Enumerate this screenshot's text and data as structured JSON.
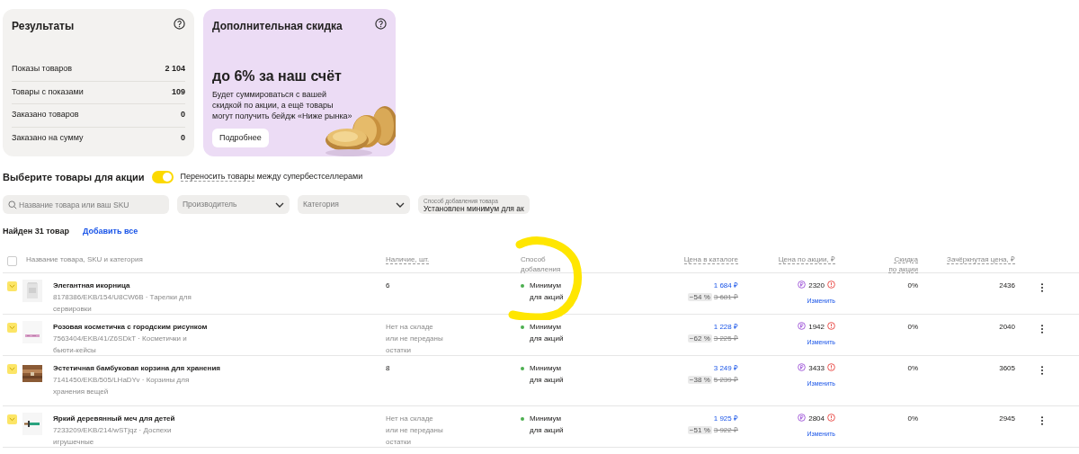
{
  "results_card": {
    "title": "Результаты",
    "stats": [
      {
        "label": "Показы товаров",
        "value": "2 104"
      },
      {
        "label": "Товары с показами",
        "value": "109"
      },
      {
        "label": "Заказано товаров",
        "value": "0"
      },
      {
        "label": "Заказано на сумму",
        "value": "0"
      }
    ]
  },
  "promo_card": {
    "title": "Дополнительная скидка",
    "headline": "до 6% за наш счёт",
    "text": "Будет суммироваться с вашей скидкой по акции, а ещё товары могут получить бейдж «Ниже рынка»",
    "button": "Подробнее"
  },
  "selection": {
    "title": "Выберите товары для акции",
    "toggle_on": true,
    "toggle_link": "Переносить товары",
    "toggle_text": "между супербестселлерами"
  },
  "filters": {
    "search_placeholder": "Название товара или ваш SKU",
    "dropdowns": [
      {
        "placeholder": "Производитель"
      },
      {
        "placeholder": "Категория"
      },
      {
        "label": "Способ добавления товара",
        "value": "Установлен минимум для ак"
      }
    ]
  },
  "found": "Найден 31 товар",
  "add_all": "Добавить все",
  "table": {
    "all_checked": false,
    "columns": [
      "Название товара, SKU и категория",
      "Наличие, шт.",
      "Способ добавления",
      "Цена в каталоге",
      "Цена по акции, ₽",
      "Скидка по акции",
      "Зачёркнутая цена, ₽"
    ],
    "rows": [
      {
        "checked": true,
        "name": "Элегантная икорница",
        "sku_category": "8178386/EKB/154/U8CW6B · Тарелки для сервировки",
        "stock": "6",
        "available": true,
        "method": "Минимум для акций",
        "catalog_price": "1 684 ₽",
        "discount_badge": "−54 %",
        "old_price": "3 681 ₽",
        "promo_price": "2320",
        "change_link": "Изменить",
        "promo_discount": "0%",
        "crossed_price": "2436"
      },
      {
        "checked": true,
        "name": "Розовая косметичка с городским рисунком",
        "sku_category": "7563404/EKB/41/Z6SDkT · Косметички и бьюти-кейсы",
        "stock": "Нет на складе или не переданы остатки",
        "available": false,
        "method": "Минимум для акций",
        "catalog_price": "1 228 ₽",
        "discount_badge": "−62 %",
        "old_price": "3 225 ₽",
        "promo_price": "1942",
        "change_link": "Изменить",
        "promo_discount": "0%",
        "crossed_price": "2040"
      },
      {
        "checked": true,
        "name": "Эстетичная бамбуковая корзина для хранения",
        "sku_category": "7141450/EKB/505/LHaDYv · Корзины для хранения вещей",
        "stock": "8",
        "available": true,
        "method": "Минимум для акций",
        "catalog_price": "3 249 ₽",
        "discount_badge": "−38 %",
        "old_price": "5 239 ₽",
        "promo_price": "3433",
        "change_link": "Изменить",
        "promo_discount": "0%",
        "crossed_price": "3605"
      },
      {
        "checked": true,
        "name": "Яркий деревянный меч для детей",
        "sku_category": "7233209/EKB/214/wSTjqz · Доспехи игрушечные",
        "stock": "Нет на складе или не переданы остатки",
        "available": false,
        "method": "Минимум для акций",
        "catalog_price": "1 925 ₽",
        "discount_badge": "−51 %",
        "old_price": "3 922 ₽",
        "promo_price": "2804",
        "change_link": "Изменить",
        "promo_discount": "0%",
        "crossed_price": "2945"
      }
    ]
  }
}
